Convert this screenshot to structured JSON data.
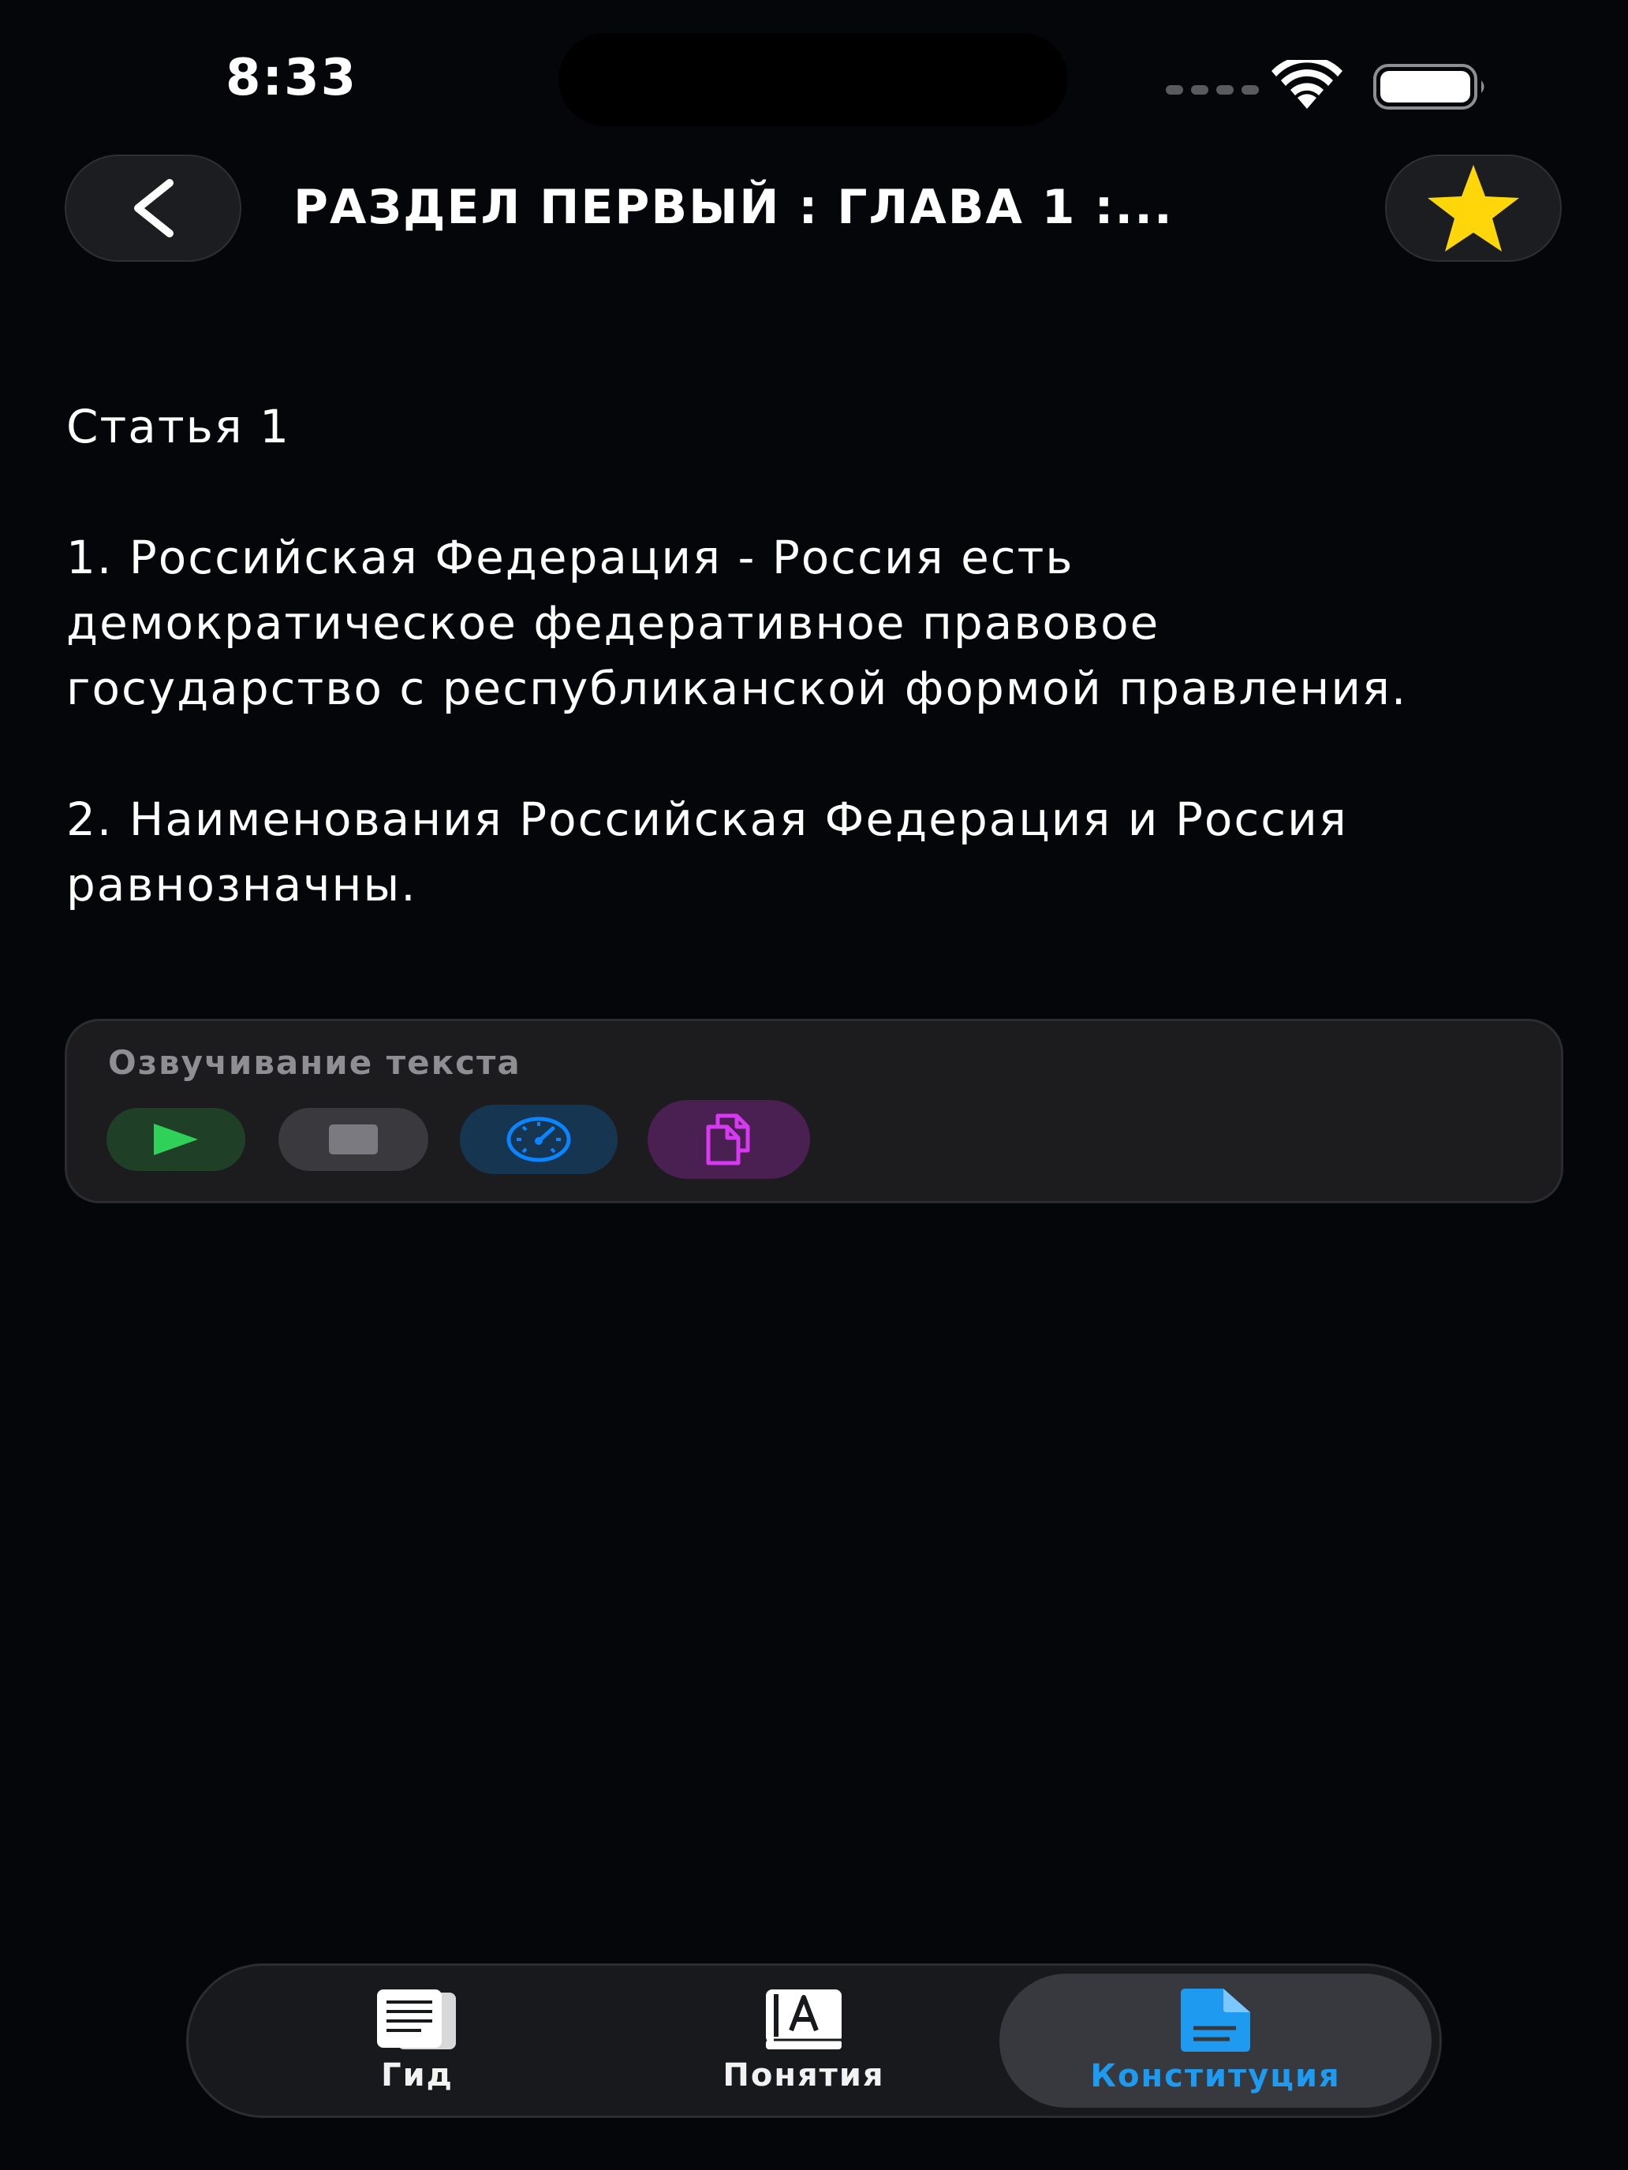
{
  "status_bar": {
    "time": "8:33"
  },
  "header": {
    "title": "РАЗДЕЛ ПЕРВЫЙ : ГЛАВА 1 :...",
    "back_icon": "chevron-left-icon",
    "favorite_icon": "star-icon",
    "favorite_color": "#FFD60A"
  },
  "article": {
    "heading": "Статья 1",
    "paragraphs": [
      "1. Российская Федерация - Россия есть демократическое федеративное правовое государство с республиканской формой правления.",
      "2. Наименования Российская Федерация и Россия равнозначны."
    ]
  },
  "tts": {
    "label": "Озвучивание текста",
    "buttons": [
      {
        "icon": "play-icon",
        "color": "#30D158"
      },
      {
        "icon": "stop-icon",
        "color": "#8E8E93"
      },
      {
        "icon": "speedometer-icon",
        "color": "#0A84FF"
      },
      {
        "icon": "copy-icon",
        "color": "#D63AF0"
      }
    ]
  },
  "tabbar": {
    "tabs": [
      {
        "label": "Гид",
        "icon": "guide-book-icon",
        "selected": false
      },
      {
        "label": "Понятия",
        "icon": "dictionary-icon",
        "selected": false
      },
      {
        "label": "Конституция",
        "icon": "document-icon",
        "selected": true
      }
    ],
    "accent_color": "#1E9BF0"
  }
}
